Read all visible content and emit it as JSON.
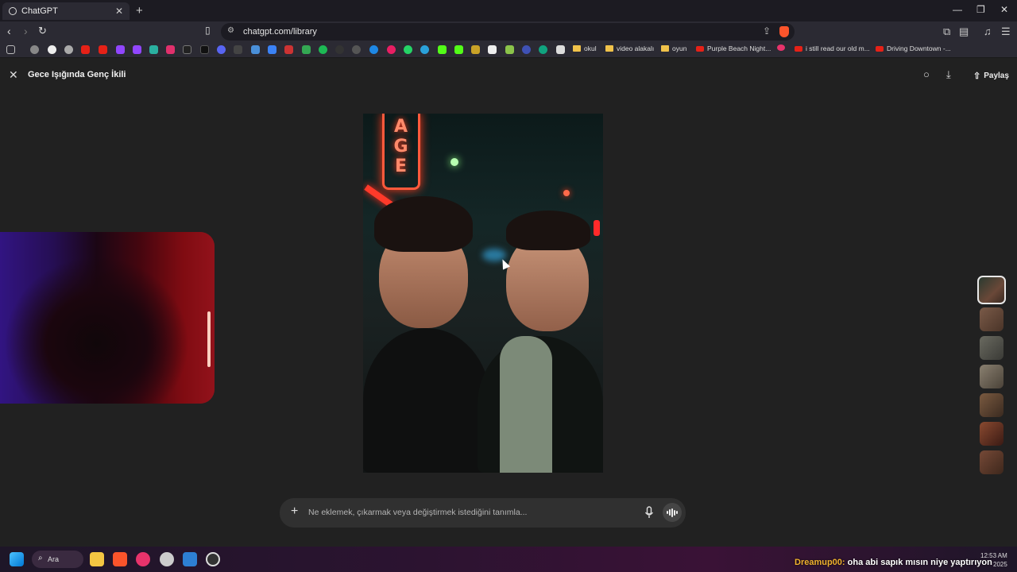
{
  "browser": {
    "tab_title": "ChatGPT",
    "url": "chatgpt.com/library",
    "bookmark_folders": [
      "okul",
      "video alakalı",
      "oyun"
    ],
    "bookmark_links": [
      "Purple Beach Night...",
      "i still read our old m...",
      "Driving Downtown -..."
    ]
  },
  "header": {
    "title": "Gece Işığında Genç İkili",
    "share_label": "Paylaş"
  },
  "prompt": {
    "placeholder": "Ne eklemek, çıkarmak veya değiştirmek istediğini tanımla..."
  },
  "main_image": {
    "sign_text": "AGE"
  },
  "taskbar": {
    "search_label": "Ara",
    "time": "12:53 AM",
    "date_fragment": "2025"
  },
  "overlay_chat": {
    "username": "Dreamup00:",
    "message": "oha abi sapık mısın niye yaptırıyon"
  },
  "colors": {
    "background": "#212121",
    "accent_neon": "#ff5a3c",
    "chat_username": "#f1b22f"
  },
  "icons": [
    "close-icon",
    "chat-bubble-icon",
    "download-icon",
    "share-icon",
    "plus-icon",
    "mic-icon",
    "voice-mode-icon"
  ]
}
